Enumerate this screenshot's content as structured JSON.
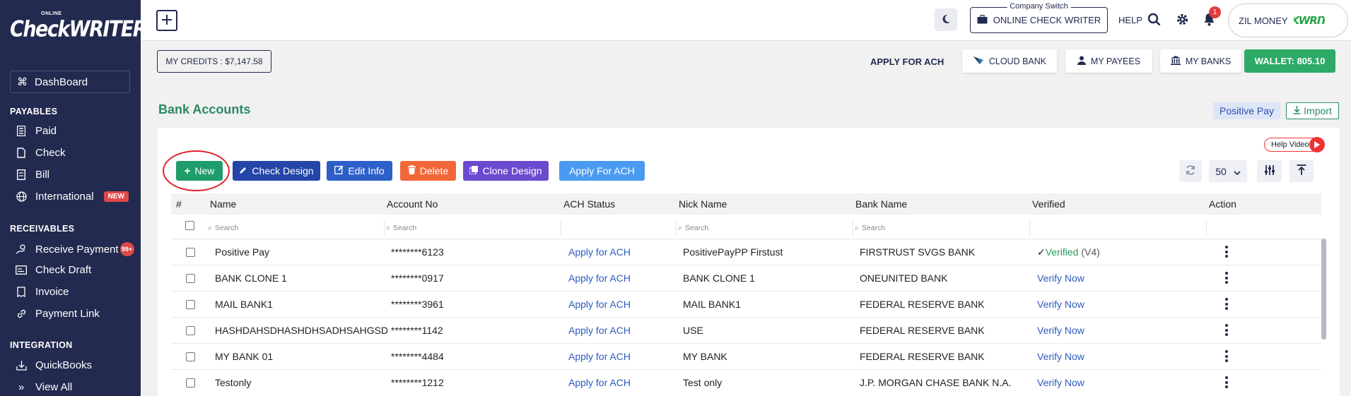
{
  "app": {
    "logo_top": "ONLINE",
    "logo_brand": "CheckWRITER"
  },
  "sidebar": {
    "dashboard": "DashBoard",
    "sections": {
      "payables": "PAYABLES",
      "receivables": "RECEIVABLES",
      "integration": "INTEGRATION"
    },
    "payables_items": [
      {
        "label": "Paid",
        "icon": "list-icon"
      },
      {
        "label": "Check",
        "icon": "document-icon"
      },
      {
        "label": "Bill",
        "icon": "bill-icon"
      },
      {
        "label": "International",
        "icon": "globe-icon",
        "badge": "NEW"
      }
    ],
    "receivables_items": [
      {
        "label": "Receive Payment",
        "icon": "hand-coin-icon",
        "badge": "99+"
      },
      {
        "label": "Check Draft",
        "icon": "check-draft-icon"
      },
      {
        "label": "Invoice",
        "icon": "invoice-icon"
      },
      {
        "label": "Payment Link",
        "icon": "link-icon"
      }
    ],
    "integration_items": [
      {
        "label": "QuickBooks",
        "icon": "download-box-icon"
      },
      {
        "label": "View All",
        "icon": "double-chevron-icon"
      }
    ]
  },
  "header": {
    "company_switch_label": "Company Switch",
    "company_name": "ONLINE CHECK WRITER",
    "help": "HELP",
    "notification_count": "1",
    "account_name": "ZIL MONEY",
    "account_logo_text": "KWRIT"
  },
  "subbar": {
    "credits": "MY CREDITS : $7,147.58",
    "apply_for_ach": "APPLY FOR ACH",
    "cloud_bank": "CLOUD BANK",
    "my_payees": "MY PAYEES",
    "my_banks": "MY BANKS",
    "wallet": "WALLET: 805.10"
  },
  "page": {
    "title": "Bank Accounts",
    "positive_pay": "Positive Pay",
    "import": "Import",
    "help_video": "Help Video"
  },
  "actions": {
    "new": "New",
    "check_design": "Check Design",
    "edit_info": "Edit Info",
    "delete": "Delete",
    "clone_design": "Clone Design",
    "apply_for_ach": "Apply For ACH",
    "page_size": "50"
  },
  "colors": {
    "sidebar_bg": "#232a4f",
    "new_btn": "#1f9c6a",
    "check_design_btn": "#2446a8",
    "edit_info_btn": "#2d5fc9",
    "delete_btn": "#f2673a",
    "clone_design_btn": "#6c4ad0",
    "apply_ach_btn": "#4a9af2",
    "wallet": "#2dab66",
    "title_green": "#2a8a62"
  },
  "table": {
    "columns": [
      "#",
      "Name",
      "Account No",
      "ACH Status",
      "Nick Name",
      "Bank Name",
      "Verified",
      "Action"
    ],
    "search_placeholder": "Search",
    "rows": [
      {
        "name": "Positive Pay",
        "account": "********6123",
        "ach": "Apply for ACH",
        "nick": "PositivePayPP Firstust",
        "bank": "FIRSTRUST SVGS BANK",
        "verified": "Verified",
        "version": "(V4)"
      },
      {
        "name": "BANK CLONE 1",
        "account": "********0917",
        "ach": "Apply for ACH",
        "nick": "BANK CLONE 1",
        "bank": "ONEUNITED BANK",
        "verified": "Verify Now",
        "version": ""
      },
      {
        "name": "MAIL BANK1",
        "account": "********3961",
        "ach": "Apply for ACH",
        "nick": "MAIL BANK1",
        "bank": "FEDERAL RESERVE BANK",
        "verified": "Verify Now",
        "version": ""
      },
      {
        "name": "HASHDAHSDHASHDHSADHSAHGSDA",
        "account": "********1142",
        "ach": "Apply for ACH",
        "nick": "USE",
        "bank": "FEDERAL RESERVE BANK",
        "verified": "Verify Now",
        "version": ""
      },
      {
        "name": "MY BANK 01",
        "account": "********4484",
        "ach": "Apply for ACH",
        "nick": "MY BANK",
        "bank": "FEDERAL RESERVE BANK",
        "verified": "Verify Now",
        "version": ""
      },
      {
        "name": "Testonly",
        "account": "********1212",
        "ach": "Apply for ACH",
        "nick": "Test only",
        "bank": "J.P. MORGAN CHASE BANK N.A.",
        "verified": "Verify Now",
        "version": ""
      }
    ]
  }
}
